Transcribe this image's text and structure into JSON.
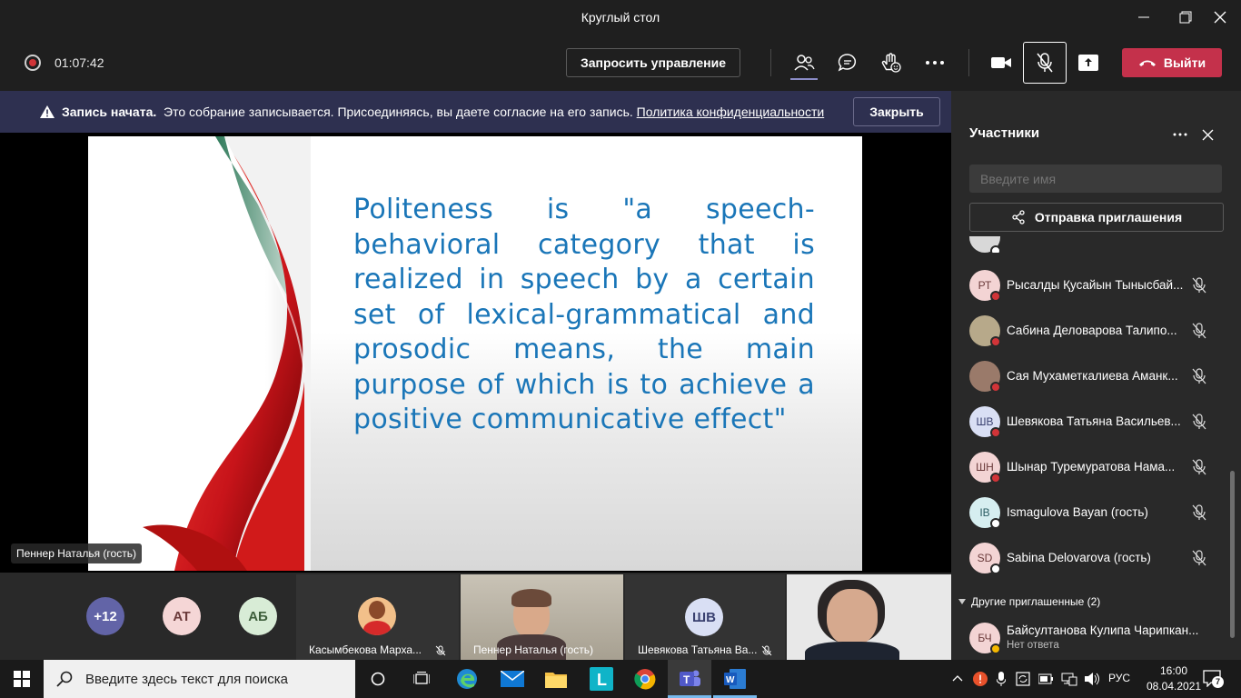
{
  "window": {
    "title": "Круглый стол"
  },
  "toolbar": {
    "timer": "01:07:42",
    "request_control_label": "Запросить управление",
    "leave_label": "Выйти"
  },
  "notification": {
    "title": "Запись начата.",
    "message": "Это собрание записывается. Присоединяясь, вы даете согласие на его запись.",
    "link": "Политика конфиденциальности",
    "close_label": "Закрыть"
  },
  "stage": {
    "slide_text": "Politeness is \"a speech-behavioral category that is realized in speech by a certain set of lexical-grammatical and prosodic means, the main purpose of which is to achieve a positive communicative effect\"",
    "presenter_label": "Пеннер Наталья (гость)"
  },
  "strip": {
    "overflow_count": "+12",
    "avatars": [
      {
        "initials": "АТ",
        "bg": "#f5d6d6",
        "color": "#6b3b3b"
      },
      {
        "initials": "АБ",
        "bg": "#d8ecd6",
        "color": "#3e5e3b"
      }
    ],
    "tiles": [
      {
        "label": "Касымбекова Марха..."
      },
      {
        "label": "Пеннер Наталья (гость)"
      },
      {
        "label": "Шевякова Татьяна Ва...",
        "initials": "ШВ"
      }
    ]
  },
  "panel": {
    "title": "Участники",
    "search_placeholder": "Введите имя",
    "invite_label": "Отправка приглашения",
    "participants": [
      {
        "initials": "РТ",
        "name": "Рысалды Қусайын Тынысбай...",
        "bg": "#f3d4d4",
        "status": "#d13438"
      },
      {
        "initials": "",
        "name": "Сабина Деловарова Талипо...",
        "bg": "#b7a98a",
        "status": "#d13438"
      },
      {
        "initials": "",
        "name": "Сая Мухаметкалиева Аманк...",
        "bg": "#9a7a6a",
        "status": "#d13438"
      },
      {
        "initials": "ШВ",
        "name": "Шевякова Татьяна Васильев...",
        "bg": "#d9dff4",
        "status": "#d13438"
      },
      {
        "initials": "ШН",
        "name": "Шынар Туремуратова Нама...",
        "bg": "#f3d4d4",
        "status": "#d13438"
      },
      {
        "initials": "IB",
        "name": "Ismagulova Bayan (гость)",
        "bg": "#d6eef0",
        "status": "#ffffff"
      },
      {
        "initials": "SD",
        "name": "Sabina Delovarova (гость)",
        "bg": "#f3d4d4",
        "status": "#ffffff"
      }
    ],
    "other_invited_label": "Другие приглашенные (2)",
    "invited": {
      "initials": "БЧ",
      "name": "Байсултанова Кулипа Чарипкан...",
      "status_text": "Нет ответа"
    }
  },
  "taskbar": {
    "search_placeholder": "Введите здесь текст для поиска",
    "lang": "РУС",
    "time": "16:00",
    "date": "08.04.2021",
    "notification_count": "7"
  }
}
